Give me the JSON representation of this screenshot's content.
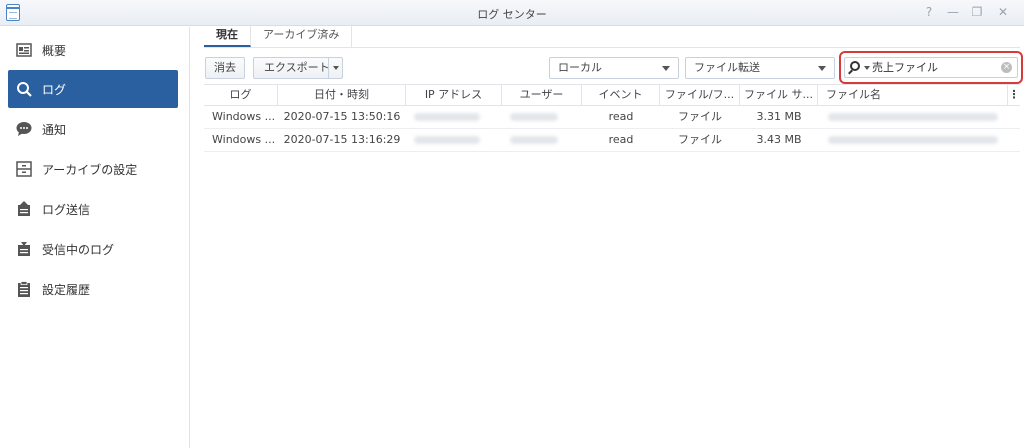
{
  "window": {
    "title": "ログ センター",
    "controls": [
      "?",
      "—",
      "❐",
      "✕"
    ]
  },
  "sidebar": {
    "items": [
      {
        "label": "概要",
        "icon": "overview-icon",
        "active": false
      },
      {
        "label": "ログ",
        "icon": "search-icon",
        "active": true
      },
      {
        "label": "通知",
        "icon": "chat-icon",
        "active": false
      },
      {
        "label": "アーカイブの設定",
        "icon": "archive-icon",
        "active": false
      },
      {
        "label": "ログ送信",
        "icon": "log-send-icon",
        "active": false
      },
      {
        "label": "受信中のログ",
        "icon": "log-receive-icon",
        "active": false
      },
      {
        "label": "設定履歴",
        "icon": "clipboard-icon",
        "active": false
      }
    ]
  },
  "tabs": [
    {
      "label": "現在",
      "active": true
    },
    {
      "label": "アーカイブ済み",
      "active": false
    }
  ],
  "toolbar": {
    "clear_label": "消去",
    "export_label": "エクスポート",
    "source_select": "ローカル",
    "type_select": "ファイル転送",
    "search_value": "売上ファイル"
  },
  "table": {
    "columns": [
      "ログ",
      "日付・時刻",
      "IP アドレス",
      "ユーザー",
      "イベント",
      "ファイル/フ...",
      "ファイル サ...",
      "ファイル名"
    ],
    "rows": [
      {
        "log": "Windows ...",
        "datetime": "2020-07-15 13:50:16",
        "event": "read",
        "file_type": "ファイル",
        "file_size": "3.31 MB"
      },
      {
        "log": "Windows ...",
        "datetime": "2020-07-15 13:16:29",
        "event": "read",
        "file_type": "ファイル",
        "file_size": "3.43 MB"
      }
    ]
  },
  "colors": {
    "accent": "#2a5fa0",
    "highlight_border": "#d83a3a"
  }
}
